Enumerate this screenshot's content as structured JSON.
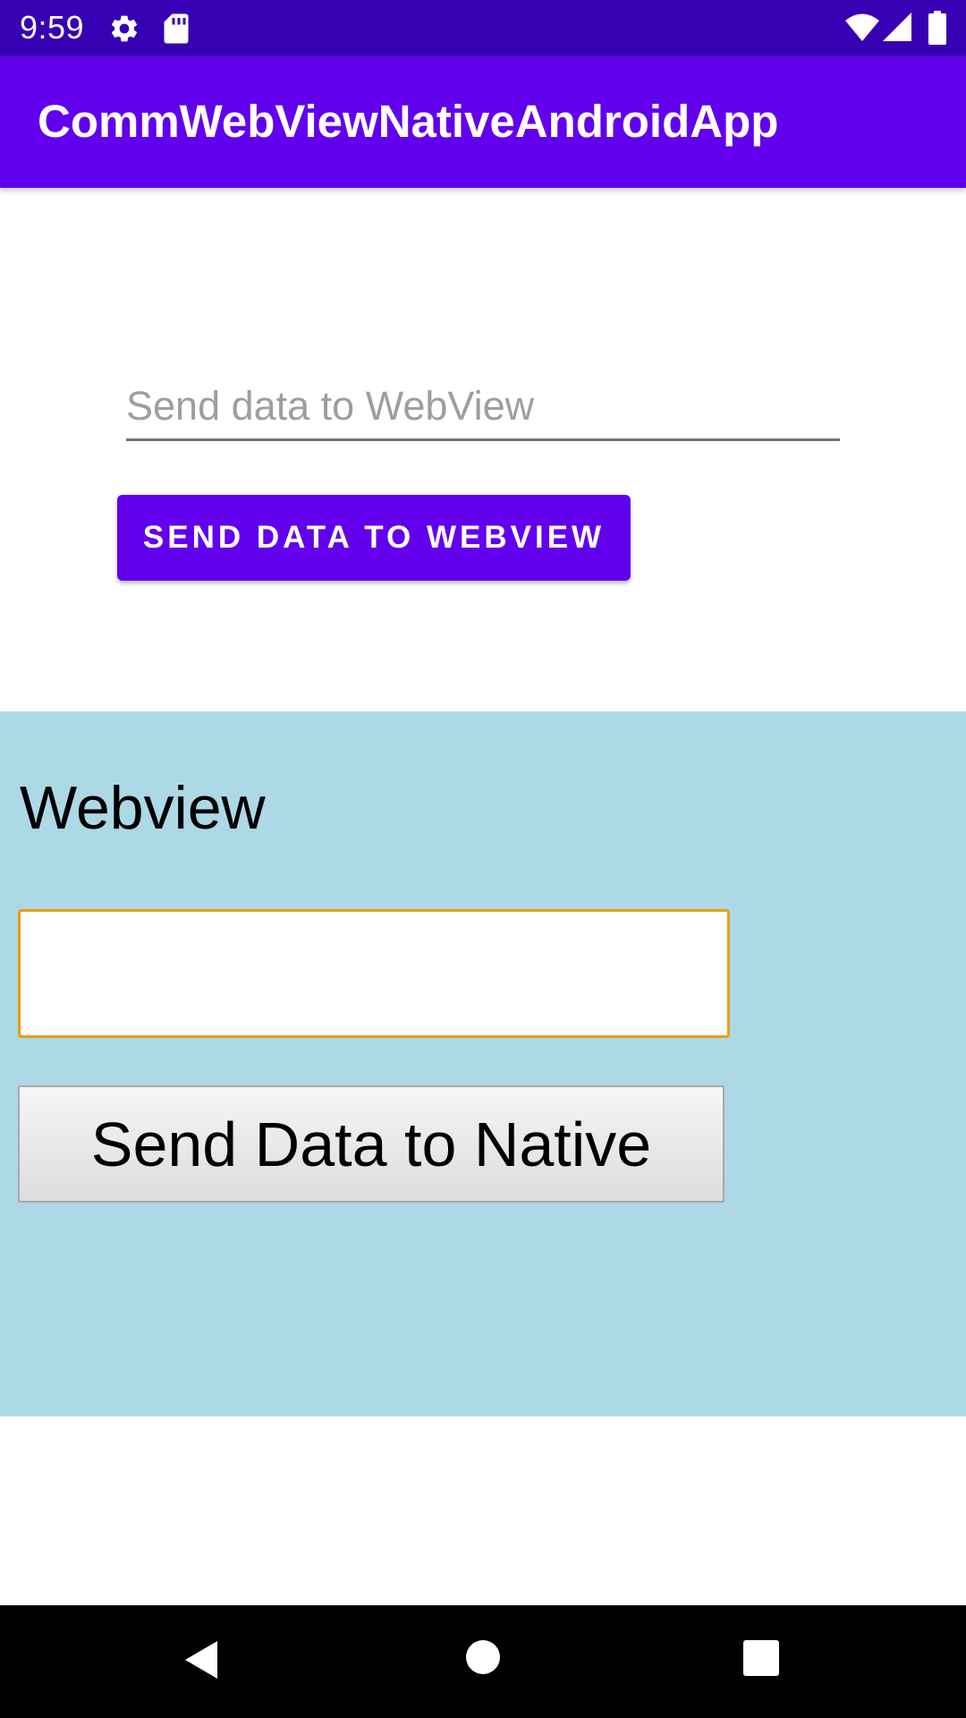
{
  "status_bar": {
    "time": "9:59",
    "icons_left": [
      "gear-icon",
      "sd-card-icon"
    ],
    "icons_right": [
      "wifi-icon",
      "cell-signal-icon",
      "battery-icon"
    ],
    "background": "#3700b3"
  },
  "app_bar": {
    "title": "CommWebViewNativeAndroidApp",
    "background": "#6200ee"
  },
  "native": {
    "input_placeholder": "Send data to WebView",
    "input_value": "",
    "send_button_label": "SEND DATA TO WEBVIEW",
    "accent": "#6200ee"
  },
  "webview": {
    "heading": "Webview",
    "input_value": "",
    "send_button_label": "Send Data to Native",
    "background": "#add8e6",
    "input_border_color": "#e5a00f"
  },
  "nav_bar": {
    "icons": [
      "back-icon",
      "home-icon",
      "recents-icon"
    ]
  }
}
